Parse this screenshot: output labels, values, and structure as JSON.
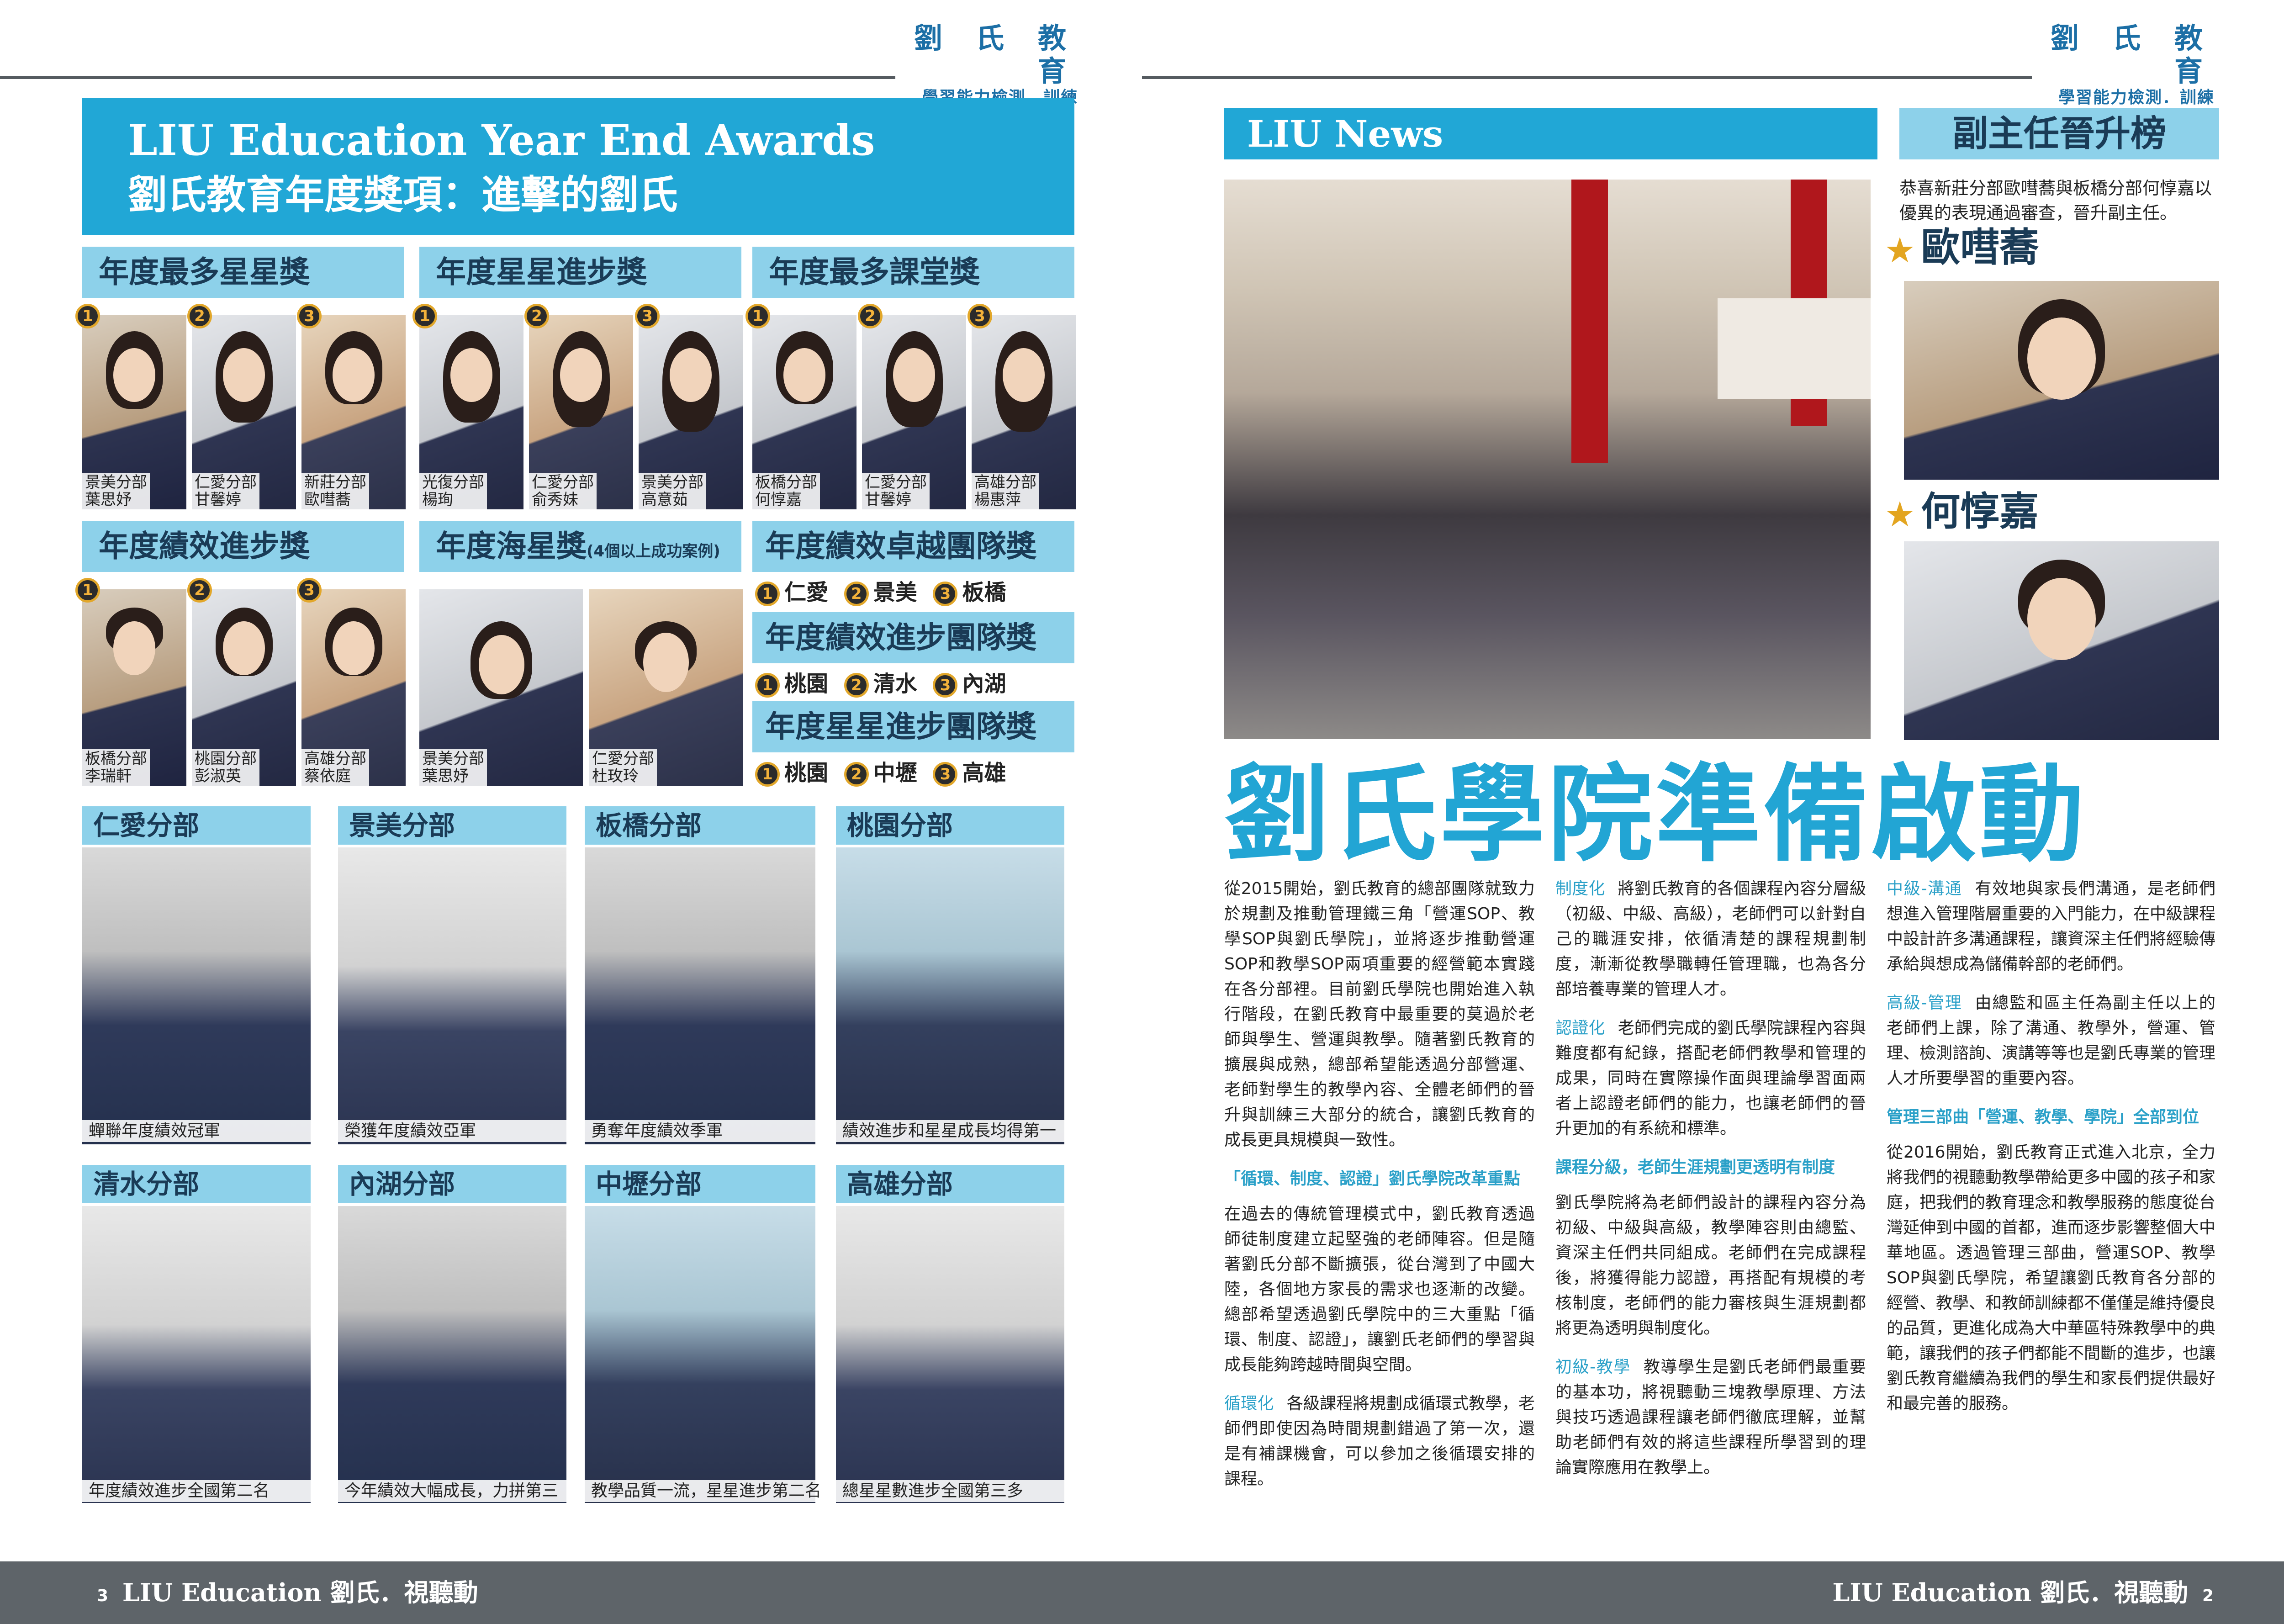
{
  "brand": {
    "name": "劉 氏 教 育",
    "tagline": "學習能力檢測．訓練"
  },
  "left": {
    "title_en": "LIU Education Year End Awards",
    "title_zh": "劉氏教育年度獎項：進擊的劉氏",
    "awards": [
      {
        "title": "年度最多星星獎",
        "winners": [
          {
            "rank": "1",
            "branch": "景美分部",
            "name": "葉思妤"
          },
          {
            "rank": "2",
            "branch": "仁愛分部",
            "name": "甘馨婷"
          },
          {
            "rank": "3",
            "branch": "新莊分部",
            "name": "歐嘒蕎"
          }
        ]
      },
      {
        "title": "年度星星進步獎",
        "winners": [
          {
            "rank": "1",
            "branch": "光復分部",
            "name": "楊珣"
          },
          {
            "rank": "2",
            "branch": "仁愛分部",
            "name": "俞秀妹"
          },
          {
            "rank": "3",
            "branch": "景美分部",
            "name": "高意茹"
          }
        ]
      },
      {
        "title": "年度最多課堂獎",
        "winners": [
          {
            "rank": "1",
            "branch": "板橋分部",
            "name": "何惇嘉"
          },
          {
            "rank": "2",
            "branch": "仁愛分部",
            "name": "甘馨婷"
          },
          {
            "rank": "3",
            "branch": "高雄分部",
            "name": "楊惠萍"
          }
        ]
      },
      {
        "title": "年度績效進步獎",
        "winners": [
          {
            "rank": "1",
            "branch": "板橋分部",
            "name": "李瑞軒"
          },
          {
            "rank": "2",
            "branch": "桃園分部",
            "name": "彭淑英"
          },
          {
            "rank": "3",
            "branch": "高雄分部",
            "name": "蔡依庭"
          }
        ]
      },
      {
        "title": "年度海星獎",
        "note": "(4個以上成功案例)",
        "winners": [
          {
            "branch": "景美分部",
            "name": "葉思妤"
          },
          {
            "branch": "仁愛分部",
            "name": "杜玫玲"
          }
        ]
      }
    ],
    "team_awards": [
      {
        "title": "年度績效卓越團隊獎",
        "ranks": [
          {
            "rank": "1",
            "name": "仁愛"
          },
          {
            "rank": "2",
            "name": "景美"
          },
          {
            "rank": "3",
            "name": "板橋"
          }
        ]
      },
      {
        "title": "年度績效進步團隊獎",
        "ranks": [
          {
            "rank": "1",
            "name": "桃園"
          },
          {
            "rank": "2",
            "name": "清水"
          },
          {
            "rank": "3",
            "name": "內湖"
          }
        ]
      },
      {
        "title": "年度星星進步團隊獎",
        "ranks": [
          {
            "rank": "1",
            "name": "桃園"
          },
          {
            "rank": "2",
            "name": "中壢"
          },
          {
            "rank": "3",
            "name": "高雄"
          }
        ]
      }
    ],
    "branches": [
      {
        "name": "仁愛分部",
        "caption": "蟬聯年度績效冠軍"
      },
      {
        "name": "景美分部",
        "caption": "榮獲年度績效亞軍"
      },
      {
        "name": "板橋分部",
        "caption": "勇奪年度績效季軍"
      },
      {
        "name": "桃園分部",
        "caption": "績效進步和星星成長均得第一"
      },
      {
        "name": "清水分部",
        "caption": "年度績效進步全國第二名"
      },
      {
        "name": "內湖分部",
        "caption": "今年績效大幅成長，力拼第三"
      },
      {
        "name": "中壢分部",
        "caption": "教學品質一流，星星進步第二名"
      },
      {
        "name": "高雄分部",
        "caption": "總星星數進步全國第三多"
      }
    ]
  },
  "right": {
    "news_title": "LIU News",
    "promo_title": "副主任晉升榜",
    "promo_text": "恭喜新莊分部歐嘒蕎與板橋分部何惇嘉以優異的表現通過審查，晉升副主任。",
    "promo_people": [
      "歐嘒蕎",
      "何惇嘉"
    ],
    "headline": "劉氏學院準備啟動",
    "col1": {
      "p1": "從2015開始，劉氏教育的總部團隊就致力於規劃及推動管理鐵三角「營運SOP、教學SOP與劉氏學院」，並將逐步推動營運SOP和教學SOP兩項重要的經營範本實踐在各分部裡。目前劉氏學院也開始進入執行階段，在劉氏教育中最重要的莫過於老師與學生、營運與教學。隨著劉氏教育的擴展與成熟，總部希望能透過分部營運、老師對學生的教學內容、全體老師們的晉升與訓練三大部分的統合，讓劉氏教育的成長更具規模與一致性。",
      "sub1": "「循環、制度、認證」劉氏學院改革重點",
      "p2": "在過去的傳統管理模式中，劉氏教育透過師徒制度建立起堅強的老師陣容。但是隨著劉氏分部不斷擴張，從台灣到了中國大陸，各個地方家長的需求也逐漸的改變。總部希望透過劉氏學院中的三大重點「循環、制度、認證」，讓劉氏老師們的學習與成長能夠跨越時間與空間。",
      "k3": "循環化",
      "p3": "各級課程將規劃成循環式教學，老師們即使因為時間規劃錯過了第一次，還是有補課機會，可以參加之後循環安排的課程。"
    },
    "col2": {
      "k1": "制度化",
      "p1": "將劉氏教育的各個課程內容分層級（初級、中級、高級），老師們可以針對自己的職涯安排，依循清楚的課程規劃制度，漸漸從教學職轉任管理職，也為各分部培養專業的管理人才。",
      "k2": "認證化",
      "p2": "老師們完成的劉氏學院課程內容與難度都有紀錄，搭配老師們教學和管理的成果，同時在實際操作面與理論學習面兩者上認證老師們的能力，也讓老師們的晉升更加的有系統和標準。",
      "sub": "課程分級，老師生涯規劃更透明有制度",
      "p3": "劉氏學院將為老師們設計的課程內容分為初級、中級與高級，教學陣容則由總監、資深主任們共同組成。老師們在完成課程後，將獲得能力認證，再搭配有規模的考核制度，老師們的能力審核與生涯規劃都將更為透明與制度化。",
      "k4": "初級-教學",
      "p4": "教導學生是劉氏老師們最重要的基本功，將視聽動三塊教學原理、方法與技巧透過課程讓老師們徹底理解，並幫助老師們有效的將這些課程所學習到的理論實際應用在教學上。"
    },
    "col3": {
      "k1": "中級-溝通",
      "p1": "有效地與家長們溝通，是老師們想進入管理階層重要的入門能力，在中級課程中設計許多溝通課程，讓資深主任們將經驗傳承給與想成為儲備幹部的老師們。",
      "k2": "高級-管理",
      "p2": "由總監和區主任為副主任以上的老師們上課，除了溝通、教學外，營運、管理、檢測諮詢、演講等等也是劉氏專業的管理人才所要學習的重要內容。",
      "sub": "管理三部曲「營運、教學、學院」全部到位",
      "p3": "從2016開始，劉氏教育正式進入北京，全力將我們的視聽動教學帶給更多中國的孩子和家庭，把我們的教育理念和教學服務的態度從台灣延伸到中國的首都，進而逐步影響整個大中華地區。透過管理三部曲，營運SOP、教學SOP與劉氏學院，希望讓劉氏教育各分部的經營、教學、和教師訓練都不僅僅是維持優良的品質，更進化成為大中華區特殊教學中的典範，讓我們的孩子們都能不間斷的進步，也讓劉氏教育繼續為我們的學生和家長們提供最好和最完善的服務。"
    }
  },
  "footer": {
    "left_page": "3",
    "right_page": "2",
    "brand_en": "LIU Education",
    "brand_zh": "劉氏．視聽動"
  },
  "colors": {
    "accent": "#21a7d6",
    "light": "#8dd1ea",
    "footer": "#5e6469",
    "medal_gold": "#e2a72a"
  }
}
